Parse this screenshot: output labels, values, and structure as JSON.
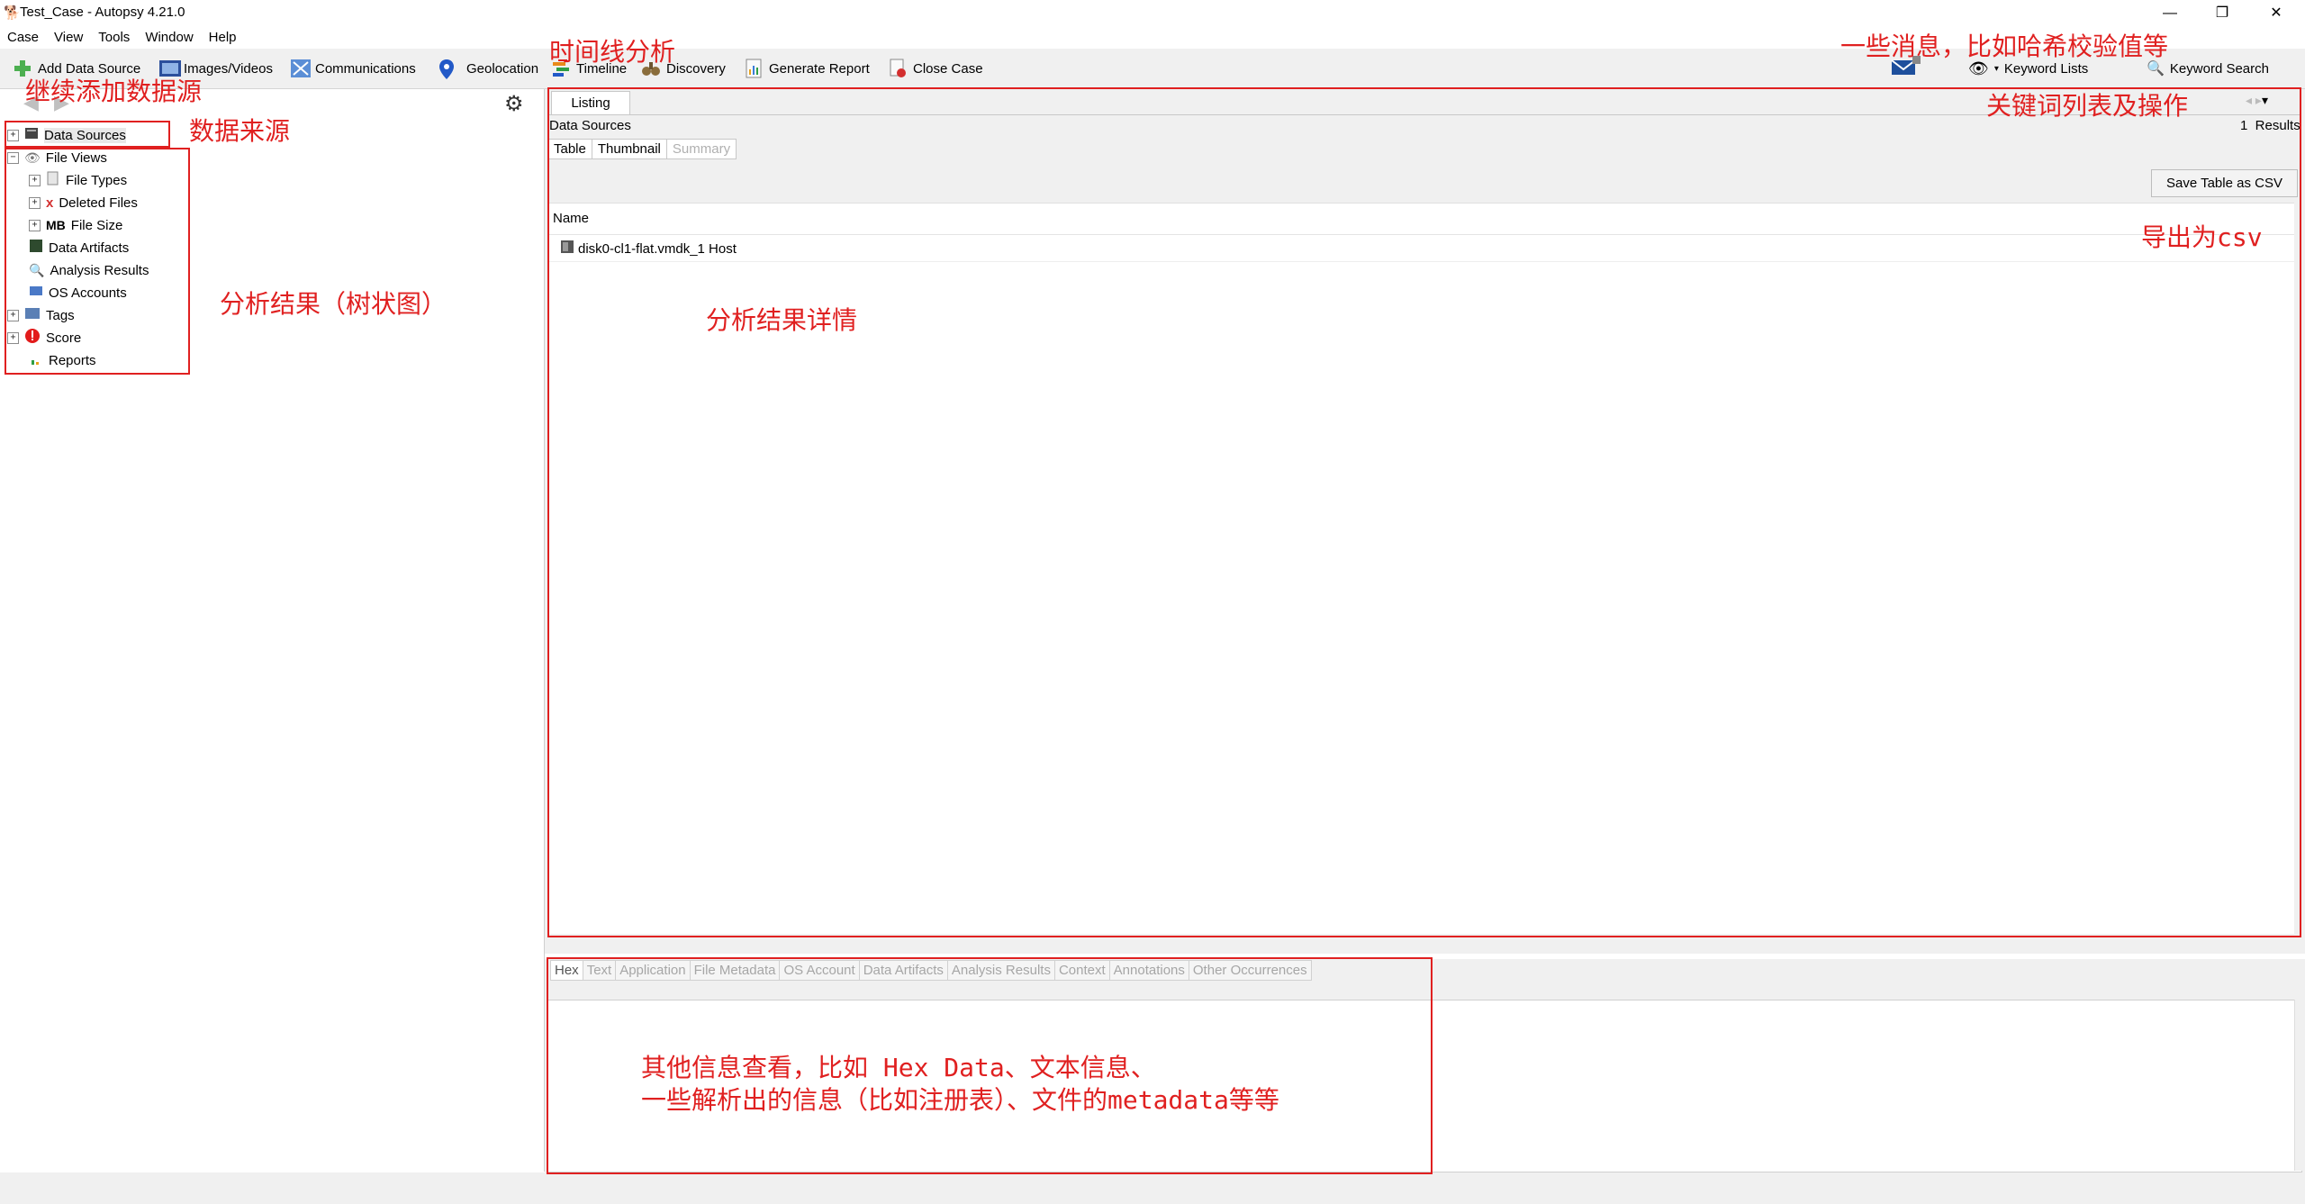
{
  "window": {
    "title": "Test_Case - Autopsy 4.21.0"
  },
  "menu": [
    "Case",
    "View",
    "Tools",
    "Window",
    "Help"
  ],
  "toolbar": {
    "add_data_source": "Add Data Source",
    "images_videos": "Images/Videos",
    "communications": "Communications",
    "geolocation": "Geolocation",
    "timeline": "Timeline",
    "discovery": "Discovery",
    "generate_report": "Generate Report",
    "close_case": "Close Case",
    "keyword_lists": "Keyword Lists",
    "keyword_search": "Keyword Search"
  },
  "tree": {
    "data_sources": "Data Sources",
    "file_views": "File Views",
    "file_types": "File Types",
    "deleted_files": "Deleted Files",
    "file_size_badge": "MB",
    "file_size": "File Size",
    "data_artifacts": "Data Artifacts",
    "analysis_results": "Analysis Results",
    "os_accounts": "OS Accounts",
    "tags": "Tags",
    "score": "Score",
    "reports": "Reports"
  },
  "listing": {
    "tab": "Listing",
    "breadcrumb": "Data Sources",
    "results": "1  Results",
    "subtabs": [
      "Table",
      "Thumbnail",
      "Summary"
    ],
    "save_csv": "Save Table as CSV",
    "column_name": "Name",
    "rows": [
      "disk0-cl1-flat.vmdk_1 Host"
    ]
  },
  "content_tabs": [
    "Hex",
    "Text",
    "Application",
    "File Metadata",
    "OS Account",
    "Data Artifacts",
    "Analysis Results",
    "Context",
    "Annotations",
    "Other Occurrences"
  ],
  "annotations": {
    "timeline": "时间线分析",
    "messages": "一些消息，比如哈希校验值等",
    "add_ds": "继续添加数据源",
    "data_source": "数据来源",
    "keyword": "关键词列表及操作",
    "tree": "分析结果（树状图）",
    "export": "导出为csv",
    "detail": "分析结果详情",
    "other1": "其他信息查看，比如 Hex Data、文本信息、",
    "other2": "一些解析出的信息（比如注册表）、文件的metadata等等"
  },
  "colors": {
    "annotation": "#e02020",
    "panel_bg": "#f0f0f0"
  }
}
